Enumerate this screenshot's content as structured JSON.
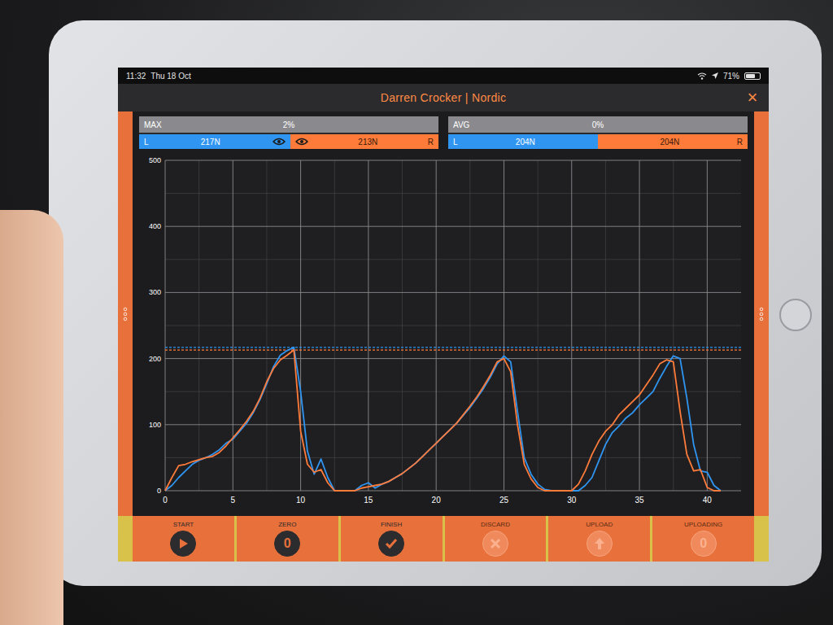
{
  "status_bar": {
    "time": "11:32",
    "date": "Thu 18 Oct",
    "battery": "71%",
    "battery_level": 0.71
  },
  "title_bar": {
    "title": "Darren  Crocker | Nordic",
    "close": "×"
  },
  "stats": [
    {
      "label": "MAX",
      "difference": "2%",
      "level": 0.505,
      "eye": true,
      "left": {
        "side": "L",
        "value": "217N"
      },
      "right": {
        "side": "R",
        "value": "213N"
      }
    },
    {
      "label": "AVG",
      "difference": "0%",
      "level": 0.5,
      "eye": false,
      "left": {
        "side": "L",
        "value": "204N"
      },
      "right": {
        "side": "R",
        "value": "204N"
      }
    }
  ],
  "chart": {
    "y_ticks": [
      "0",
      "100",
      "200",
      "300",
      "400",
      "500"
    ],
    "x_ticks": [
      "0",
      "5",
      "10",
      "15",
      "20",
      "25",
      "30",
      "35",
      "40"
    ],
    "series": [
      {
        "name": "L",
        "color": "#2f95f0",
        "values": [
          0,
          8,
          20,
          30,
          40,
          46,
          50,
          55,
          62,
          72,
          78,
          90,
          102,
          118,
          138,
          162,
          188,
          205,
          212,
          217,
          150,
          60,
          25,
          48,
          20,
          0,
          0,
          0,
          0,
          8,
          12,
          4,
          10,
          14,
          20,
          26,
          34,
          42,
          52,
          62,
          72,
          82,
          92,
          102,
          114,
          126,
          140,
          155,
          172,
          192,
          204,
          195,
          120,
          50,
          25,
          10,
          2,
          0,
          0,
          0,
          0,
          0,
          8,
          20,
          45,
          70,
          88,
          98,
          110,
          118,
          130,
          140,
          150,
          170,
          188,
          204,
          200,
          140,
          70,
          30,
          28,
          8,
          0
        ]
      },
      {
        "name": "R",
        "color": "#ff7b3a",
        "values": [
          0,
          20,
          38,
          40,
          44,
          47,
          50,
          52,
          58,
          68,
          80,
          92,
          105,
          120,
          140,
          165,
          185,
          198,
          205,
          213,
          90,
          40,
          28,
          32,
          12,
          0,
          0,
          0,
          0,
          4,
          6,
          8,
          10,
          14,
          20,
          26,
          34,
          42,
          52,
          62,
          72,
          82,
          92,
          102,
          115,
          128,
          142,
          158,
          175,
          195,
          200,
          180,
          100,
          40,
          18,
          5,
          0,
          0,
          0,
          0,
          0,
          10,
          30,
          55,
          75,
          90,
          100,
          115,
          125,
          135,
          145,
          160,
          175,
          192,
          198,
          195,
          120,
          55,
          30,
          32,
          5,
          0,
          0
        ]
      }
    ]
  },
  "buttons": [
    {
      "label": "START",
      "kind": "play",
      "disabled": false
    },
    {
      "label": "ZERO",
      "kind": "glyph",
      "glyph": "0",
      "disabled": false
    },
    {
      "label": "FINISH",
      "kind": "check",
      "disabled": false
    },
    {
      "label": "DISCARD",
      "kind": "cross",
      "disabled": true
    },
    {
      "label": "UPLOAD",
      "kind": "upload",
      "disabled": true
    },
    {
      "label": "UPLOADING",
      "kind": "glyph",
      "glyph": "0",
      "disabled": true
    }
  ]
}
